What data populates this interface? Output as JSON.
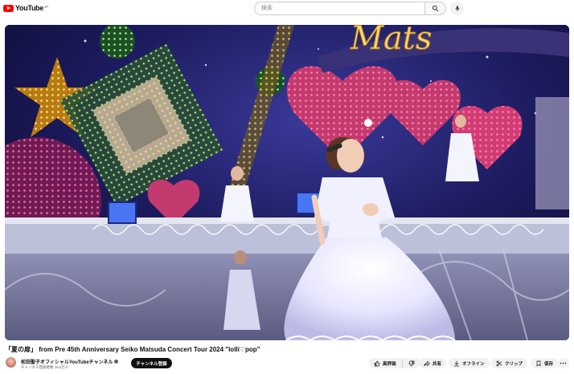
{
  "header": {
    "logo_text": "YouTube",
    "logo_country": "JP",
    "search_placeholder": "検索"
  },
  "video": {
    "title": "「夏の扉」 from Pre 45th Anniversary Seiko Matsuda Concert Tour 2024 \"lolli♡pop\"",
    "stage_sign_text": "Mats"
  },
  "channel": {
    "name": "松田聖子オフィシャルYouTubeチャンネル",
    "subscribers": "チャンネル登録者数 18.6万人",
    "subscribe_label": "チャンネル登録"
  },
  "actions": {
    "like_label": "高評価",
    "share_label": "共有",
    "offline_label": "オフライン",
    "clip_label": "クリップ",
    "save_label": "保存"
  },
  "colors": {
    "brand_red": "#ff0000",
    "subscribe_bg": "#0f0f0f",
    "pill_bg": "#f2f2f2"
  }
}
